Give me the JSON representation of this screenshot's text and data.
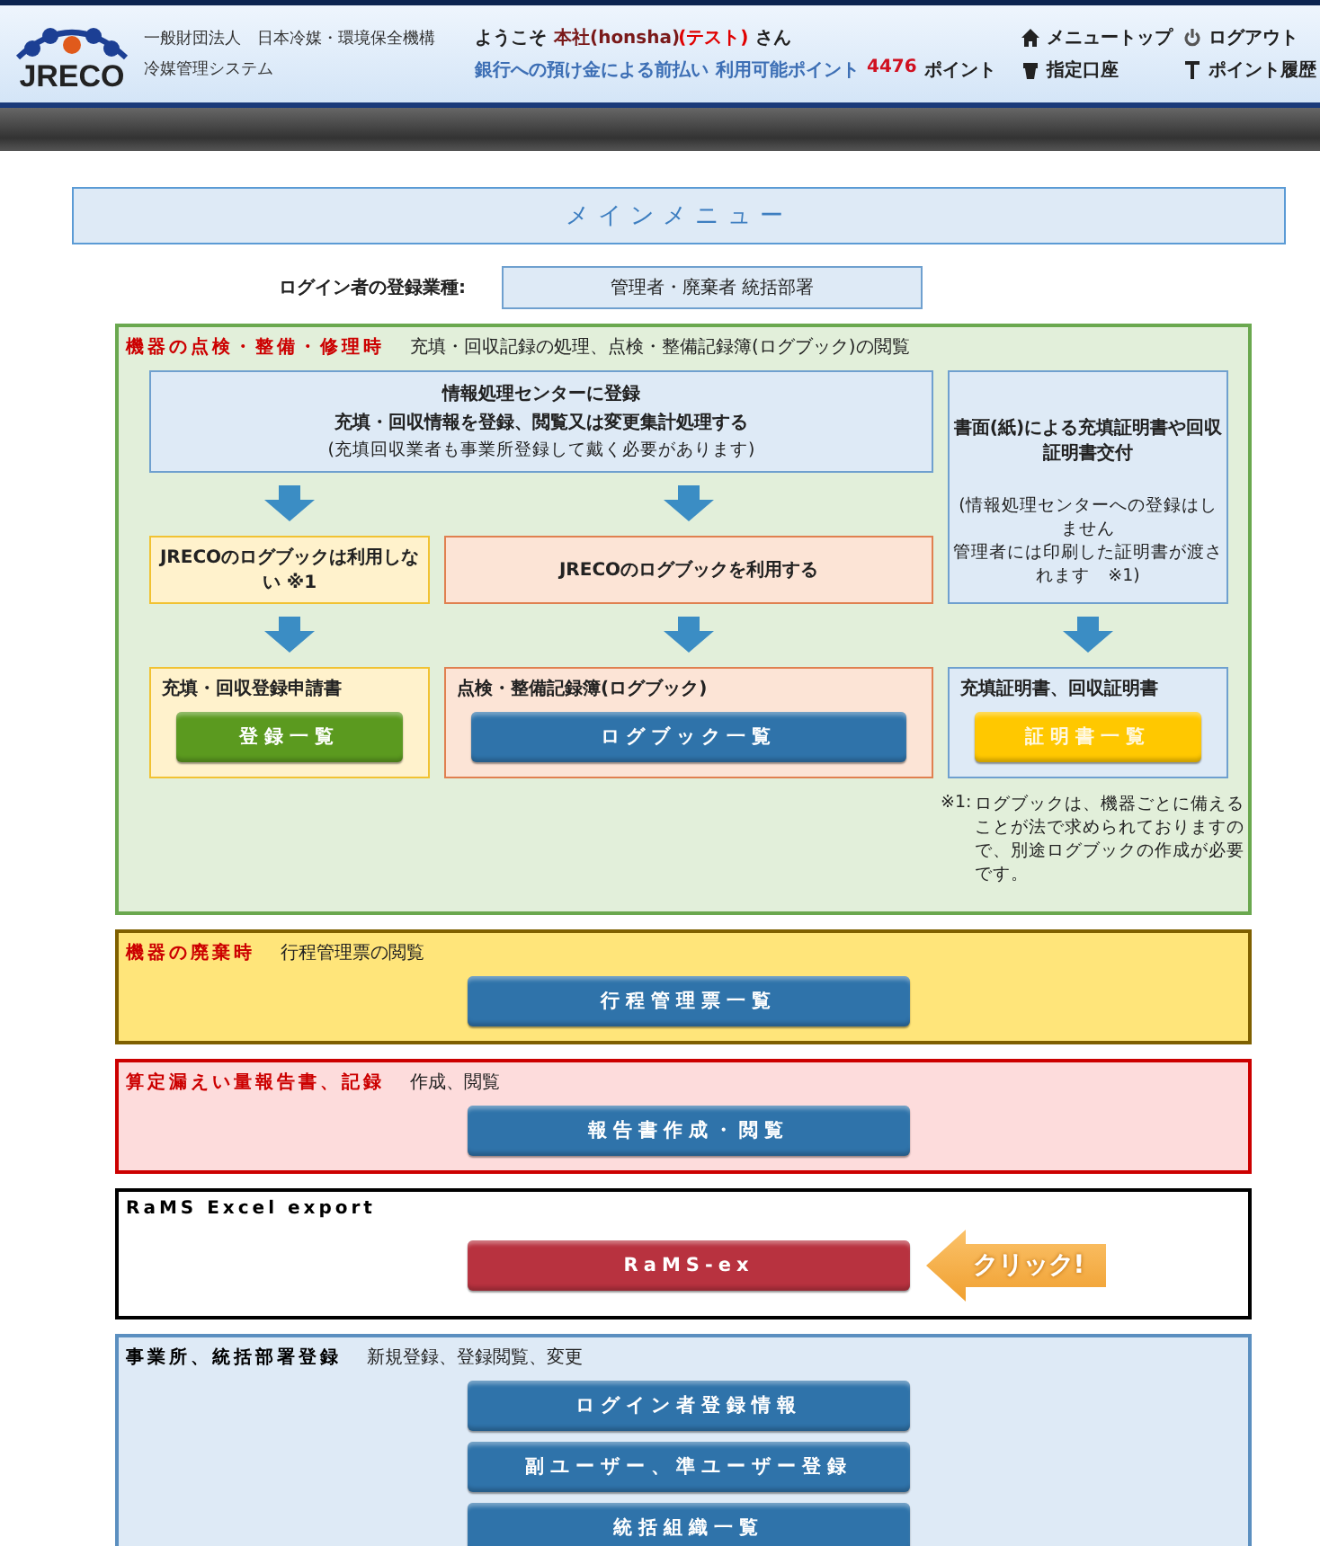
{
  "header": {
    "logo_text": "JRECO",
    "org": "一般財団法人　日本冷媒・環境保全機構",
    "system": "冷媒管理システム",
    "welcome": {
      "prefix": "ようこそ",
      "user": "本社(honsha)",
      "tag": "(テスト)",
      "suffix": "さん"
    },
    "payment": {
      "mode": "銀行への預け金による前払い",
      "points_label": "利用可能ポイント",
      "points": "4476",
      "unit": "ポイント"
    },
    "nav": [
      {
        "label": "メニュートップ",
        "kind": "home"
      },
      {
        "label": "ログアウト",
        "kind": "logout"
      },
      {
        "label": "指定口座",
        "kind": "account"
      },
      {
        "label": "ポイント履歴",
        "kind": "history"
      }
    ]
  },
  "title": "メインメニュー",
  "login_type": {
    "label": "ログイン者の登録業種:",
    "value": "管理者・廃棄者 統括部署"
  },
  "flow_section": {
    "title": "機器の点検・整備・修理時",
    "description": "充填・回収記録の処理、点検・整備記録簿(ログブック)の閲覧",
    "register_box": {
      "lines": [
        "情報処理センターに登録",
        "充填・回収情報を登録、閲覧又は変更集計処理する"
      ],
      "note": "(充填回収業者も事業所登録して戴く必要があります)"
    },
    "paper_box": {
      "title": "書面(紙)による充填証明書や回収証明書交付",
      "notes": [
        "(情報処理センターへの登録はしません",
        "管理者には印刷した証明書が渡されます　※1)"
      ]
    },
    "choices": [
      {
        "label": "JRECOのログブックは利用しない ※1",
        "kind": "yellow"
      },
      {
        "label": "JRECOのログブックを利用する",
        "kind": "orange"
      }
    ],
    "panels": [
      {
        "title": "充填・回収登録申請書",
        "kind": "yellow",
        "button": {
          "label": "登録一覧",
          "color": "#5b9a1f"
        }
      },
      {
        "title": "点検・整備記録簿(ログブック)",
        "kind": "orange",
        "button": {
          "label": "ログブック一覧",
          "color": "#2f73aa"
        }
      },
      {
        "title": "充填証明書、回収証明書",
        "kind": "blue",
        "button": {
          "label": "証明書一覧",
          "color": "#ffc800"
        }
      }
    ],
    "footnote": {
      "mark": "※1:",
      "text": "ログブックは、機器ごとに備えることが法で求められておりますので、別途ログブックの作成が必要です。"
    }
  },
  "sections": [
    {
      "kind": "yellow",
      "title": "機器の廃棄時",
      "description": "行程管理票の閲覧",
      "buttons": [
        {
          "label": "行程管理票一覧",
          "color": "#2f73aa"
        }
      ]
    },
    {
      "kind": "red",
      "title": "算定漏えい量報告書、記録",
      "description": "作成、閲覧",
      "buttons": [
        {
          "label": "報告書作成・閲覧",
          "color": "#2f73aa"
        }
      ]
    },
    {
      "kind": "plain",
      "title": "RaMS Excel export",
      "buttons": [
        {
          "label": "RaMS-ex",
          "color": "#b8323f"
        }
      ],
      "callout": "クリック!"
    },
    {
      "kind": "blue",
      "title": "事業所、統括部署登録",
      "description": "新規登録、登録閲覧、変更",
      "buttons": [
        {
          "label": "ログイン者登録情報",
          "color": "#2f73aa"
        },
        {
          "label": "副ユーザー、準ユーザー登録",
          "color": "#2f73aa"
        },
        {
          "label": "統括組織一覧",
          "color": "#2f73aa"
        }
      ]
    }
  ]
}
